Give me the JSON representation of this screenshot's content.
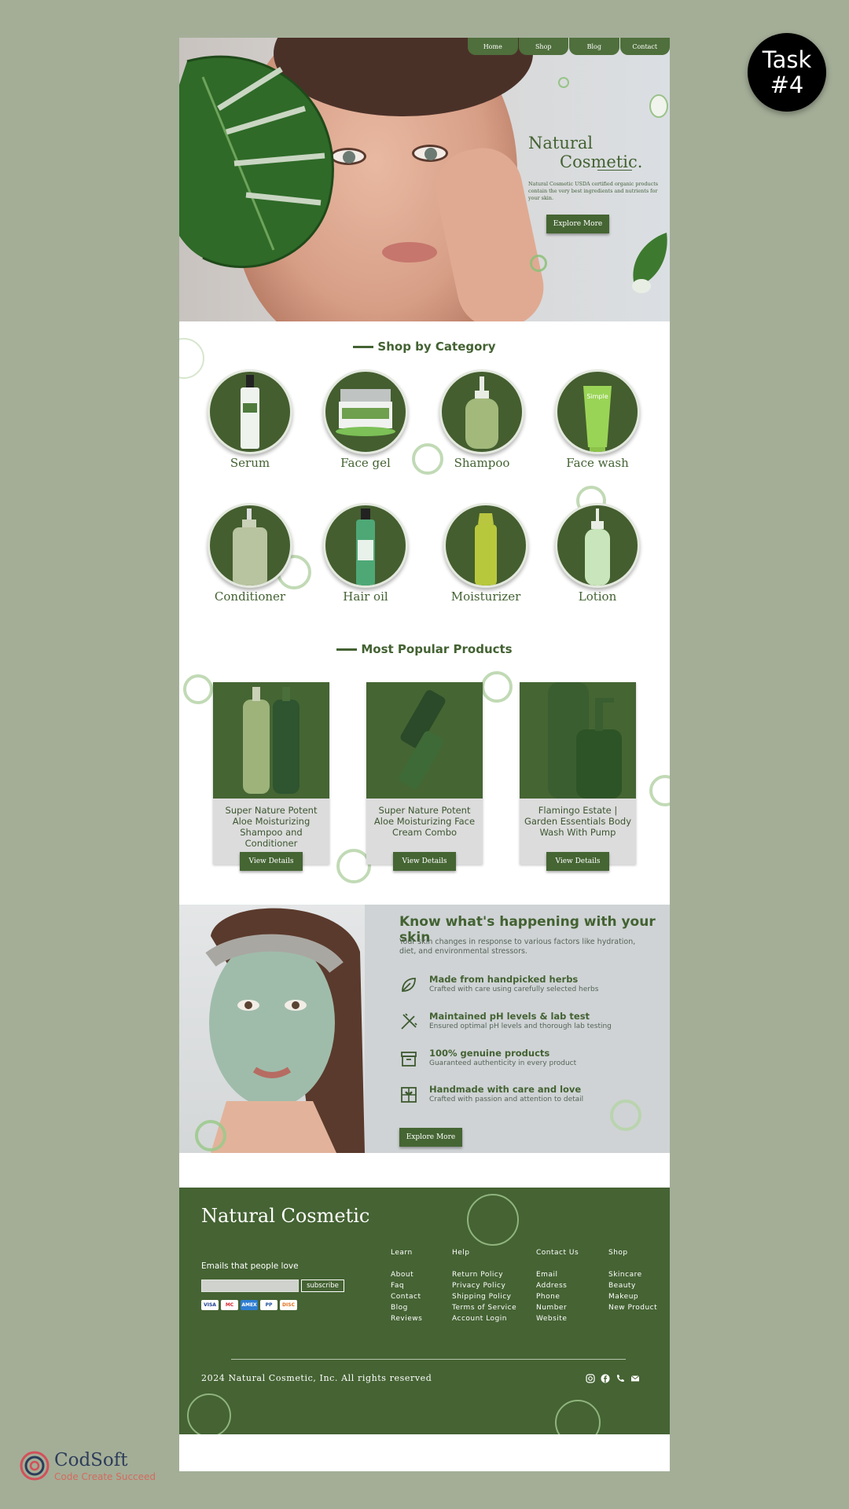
{
  "badge": {
    "line1": "Task",
    "line2": "#4"
  },
  "nav": [
    "Home",
    "Shop",
    "Blog",
    "Contact"
  ],
  "hero": {
    "title_line1": "Natural",
    "title_line2": "Cosmetic.",
    "description": "Natural Cosmetic USDA certified organic products contain the very best ingredients and nutrients for your skin.",
    "button": "Explore More"
  },
  "categories": {
    "heading": "Shop by Category",
    "items": [
      "Serum",
      "Face gel",
      "Shampoo",
      "Face wash",
      "Conditioner",
      "Hair oil",
      "Moisturizer",
      "Lotion"
    ]
  },
  "popular": {
    "heading": "Most Popular Products",
    "products": [
      {
        "name": "Super Nature Potent Aloe Moisturizing Shampoo and Conditioner",
        "button": "View Details"
      },
      {
        "name": "Super Nature Potent Aloe Moisturizing Face Cream Combo",
        "button": "View Details"
      },
      {
        "name": "Flamingo Estate | Garden Essentials Body Wash With Pump",
        "button": "View Details"
      }
    ]
  },
  "skin": {
    "heading": "Know what's happening with your skin",
    "intro": "Your skin changes in response to various factors like hydration, diet, and environmental stressors.",
    "features": [
      {
        "title": "Made from handpicked herbs",
        "sub": "Crafted with care using carefully selected herbs",
        "icon": "leaf-icon"
      },
      {
        "title": "Maintained pH levels & lab test",
        "sub": "Ensured optimal pH levels and thorough lab testing",
        "icon": "test-tube-icon"
      },
      {
        "title": "100% genuine products",
        "sub": "Guaranteed authenticity in every product",
        "icon": "box-icon"
      },
      {
        "title": "Handmade with care and love",
        "sub": "Crafted with passion and attention to detail",
        "icon": "gift-icon"
      }
    ],
    "button": "Explore More"
  },
  "footer": {
    "brand": "Natural Cosmetic",
    "emails_label": "Emails that people love",
    "subscribe": "subscribe",
    "payments": [
      "VISA",
      "MC",
      "AMEX",
      "PP",
      "DISC"
    ],
    "columns": [
      {
        "heading": "Learn",
        "items": [
          "About",
          "Faq",
          "Contact",
          "Blog",
          "Reviews"
        ]
      },
      {
        "heading": "Help",
        "items": [
          "Return Policy",
          "Privacy Policy",
          "Shipping Policy",
          "Terms of Service",
          "Account Login"
        ]
      },
      {
        "heading": "Contact Us",
        "items": [
          "Email",
          "Address",
          "Phone",
          "Number",
          "Website"
        ]
      },
      {
        "heading": "Shop",
        "items": [
          "Skincare",
          "Beauty",
          "Makeup",
          "New Product"
        ]
      }
    ],
    "copyright": "2024 Natural Cosmetic, Inc. All rights reserved",
    "social": [
      "instagram-icon",
      "facebook-icon",
      "phone-icon",
      "mail-icon"
    ]
  },
  "logo": {
    "name": "CodSoft",
    "tagline": "Code Create Succeed"
  },
  "colors": {
    "primary_green": "#456533",
    "background": "#a4ae97",
    "accent_ring": "#8bbf78"
  }
}
